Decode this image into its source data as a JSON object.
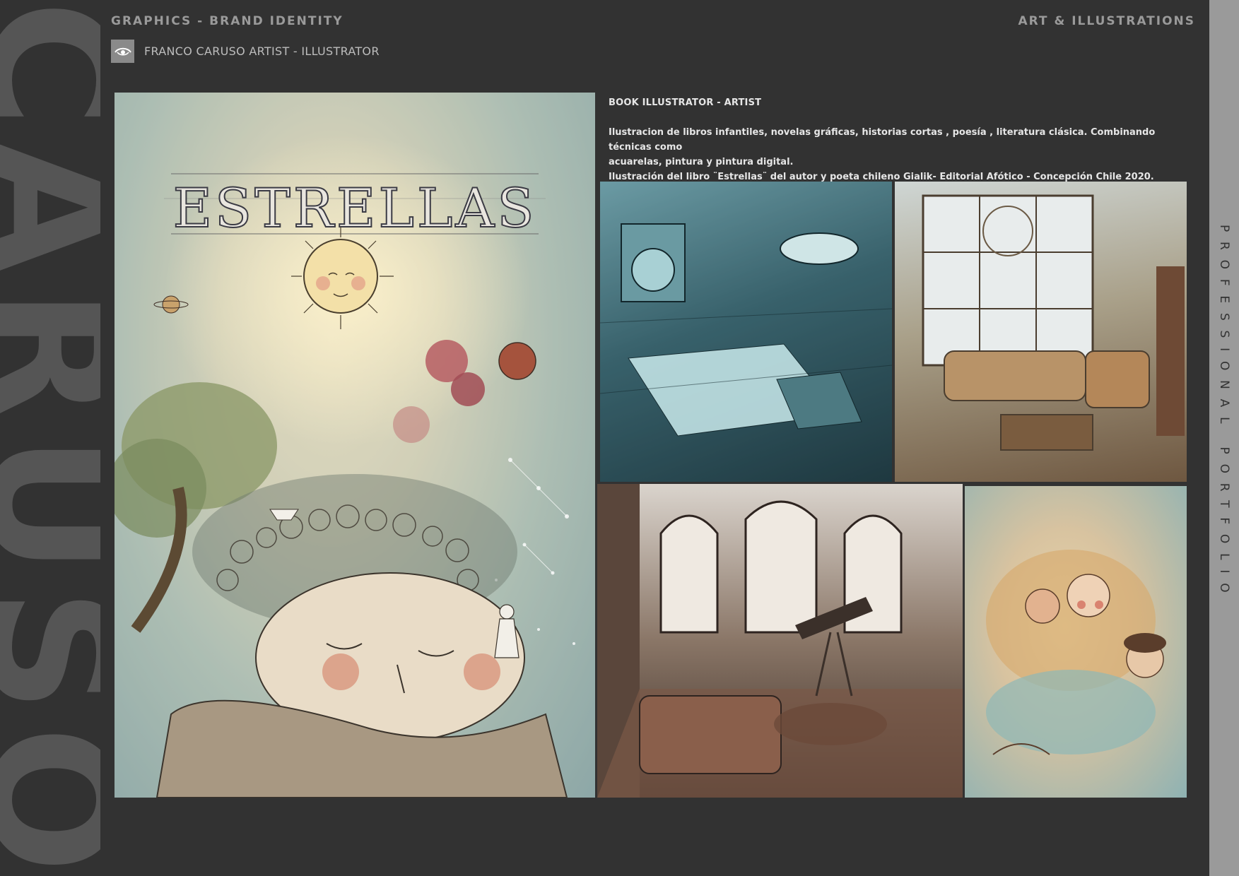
{
  "side_name": "CARUSO",
  "header": {
    "left_tag": "GRAPHICS - BRAND IDENTITY",
    "right_tag": "ART & ILLUSTRATIONS",
    "brand_name": "FRANCO CARUSO ARTIST - ILLUSTRATOR",
    "logo_icon": "eye-icon"
  },
  "right_strip": {
    "label": "PROFESSIONAL PORTFOLIO"
  },
  "main_art": {
    "title_text": "ESTRELLAS",
    "subject": "sleeping-boy-dreaming-universe"
  },
  "description": {
    "title": "BOOK ILLUSTRATOR - ARTIST",
    "lines": [
      "Ilustracion de libros infantiles, novelas gráficas, historias cortas , poesía , literatura clásica. Combinando técnicas como",
      "acuarelas, pintura y pintura digital.",
      "Ilustración del libro ¨Estrellas¨ del autor y poeta chileno Gialik- Editorial Afótico - Concepción Chile 2020."
    ]
  },
  "thumbnails": [
    {
      "subject": "blue-laundry-room"
    },
    {
      "subject": "living-room-window"
    },
    {
      "subject": "observatory-library"
    },
    {
      "subject": "sea-characters"
    }
  ],
  "colors": {
    "background": "#323232",
    "side_text": "#555555",
    "strip": "#9a9a9a",
    "muted_text": "#9a9a9a",
    "body_text": "#e6e6e6"
  }
}
